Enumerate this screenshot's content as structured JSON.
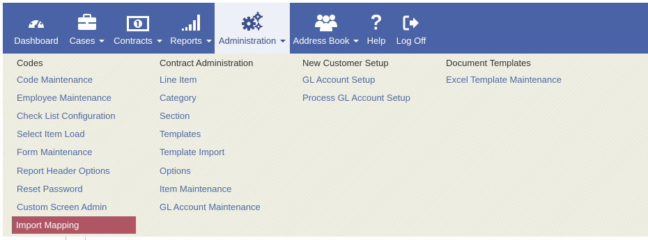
{
  "navbar": {
    "items": [
      {
        "label": "Dashboard",
        "icon": "dashboard-icon",
        "caret": false
      },
      {
        "label": "Cases",
        "icon": "briefcase-icon",
        "caret": true
      },
      {
        "label": "Contracts",
        "icon": "money-icon",
        "caret": true
      },
      {
        "label": "Reports",
        "icon": "signal-bars-icon",
        "caret": true
      },
      {
        "label": "Administration",
        "icon": "gears-icon",
        "caret": true,
        "active": true
      },
      {
        "label": "Address Book",
        "icon": "users-icon",
        "caret": true
      },
      {
        "label": "Help",
        "icon": "question-icon",
        "caret": false
      },
      {
        "label": "Log Off",
        "icon": "sign-out-icon",
        "caret": false
      }
    ]
  },
  "menu": {
    "columns": [
      {
        "header": "Codes",
        "links": [
          "Code Maintenance",
          "Employee Maintenance",
          "Check List Configuration",
          "Select Item Load",
          "Form Maintenance",
          "Report Header Options",
          "Reset Password",
          "Custom Screen Admin",
          "Import Mapping"
        ]
      },
      {
        "header": "Contract Administration",
        "links": [
          "Line Item",
          "Category",
          "Section",
          "Templates",
          "Template Import",
          "Options",
          "Item Maintenance",
          "GL Account Maintenance"
        ]
      },
      {
        "header": "New Customer Setup",
        "links": [
          "GL Account Setup",
          "Process GL Account Setup"
        ]
      },
      {
        "header": "Document Templates",
        "links": [
          "Excel Template Maintenance"
        ]
      }
    ],
    "selected": "Import Mapping"
  },
  "colors": {
    "navbar_bg": "#4a62a6",
    "active_tab_bg": "#eef0f7",
    "panel_bg": "#ebebde",
    "link": "#4e6aa4",
    "selected_bg": "#b05563"
  }
}
